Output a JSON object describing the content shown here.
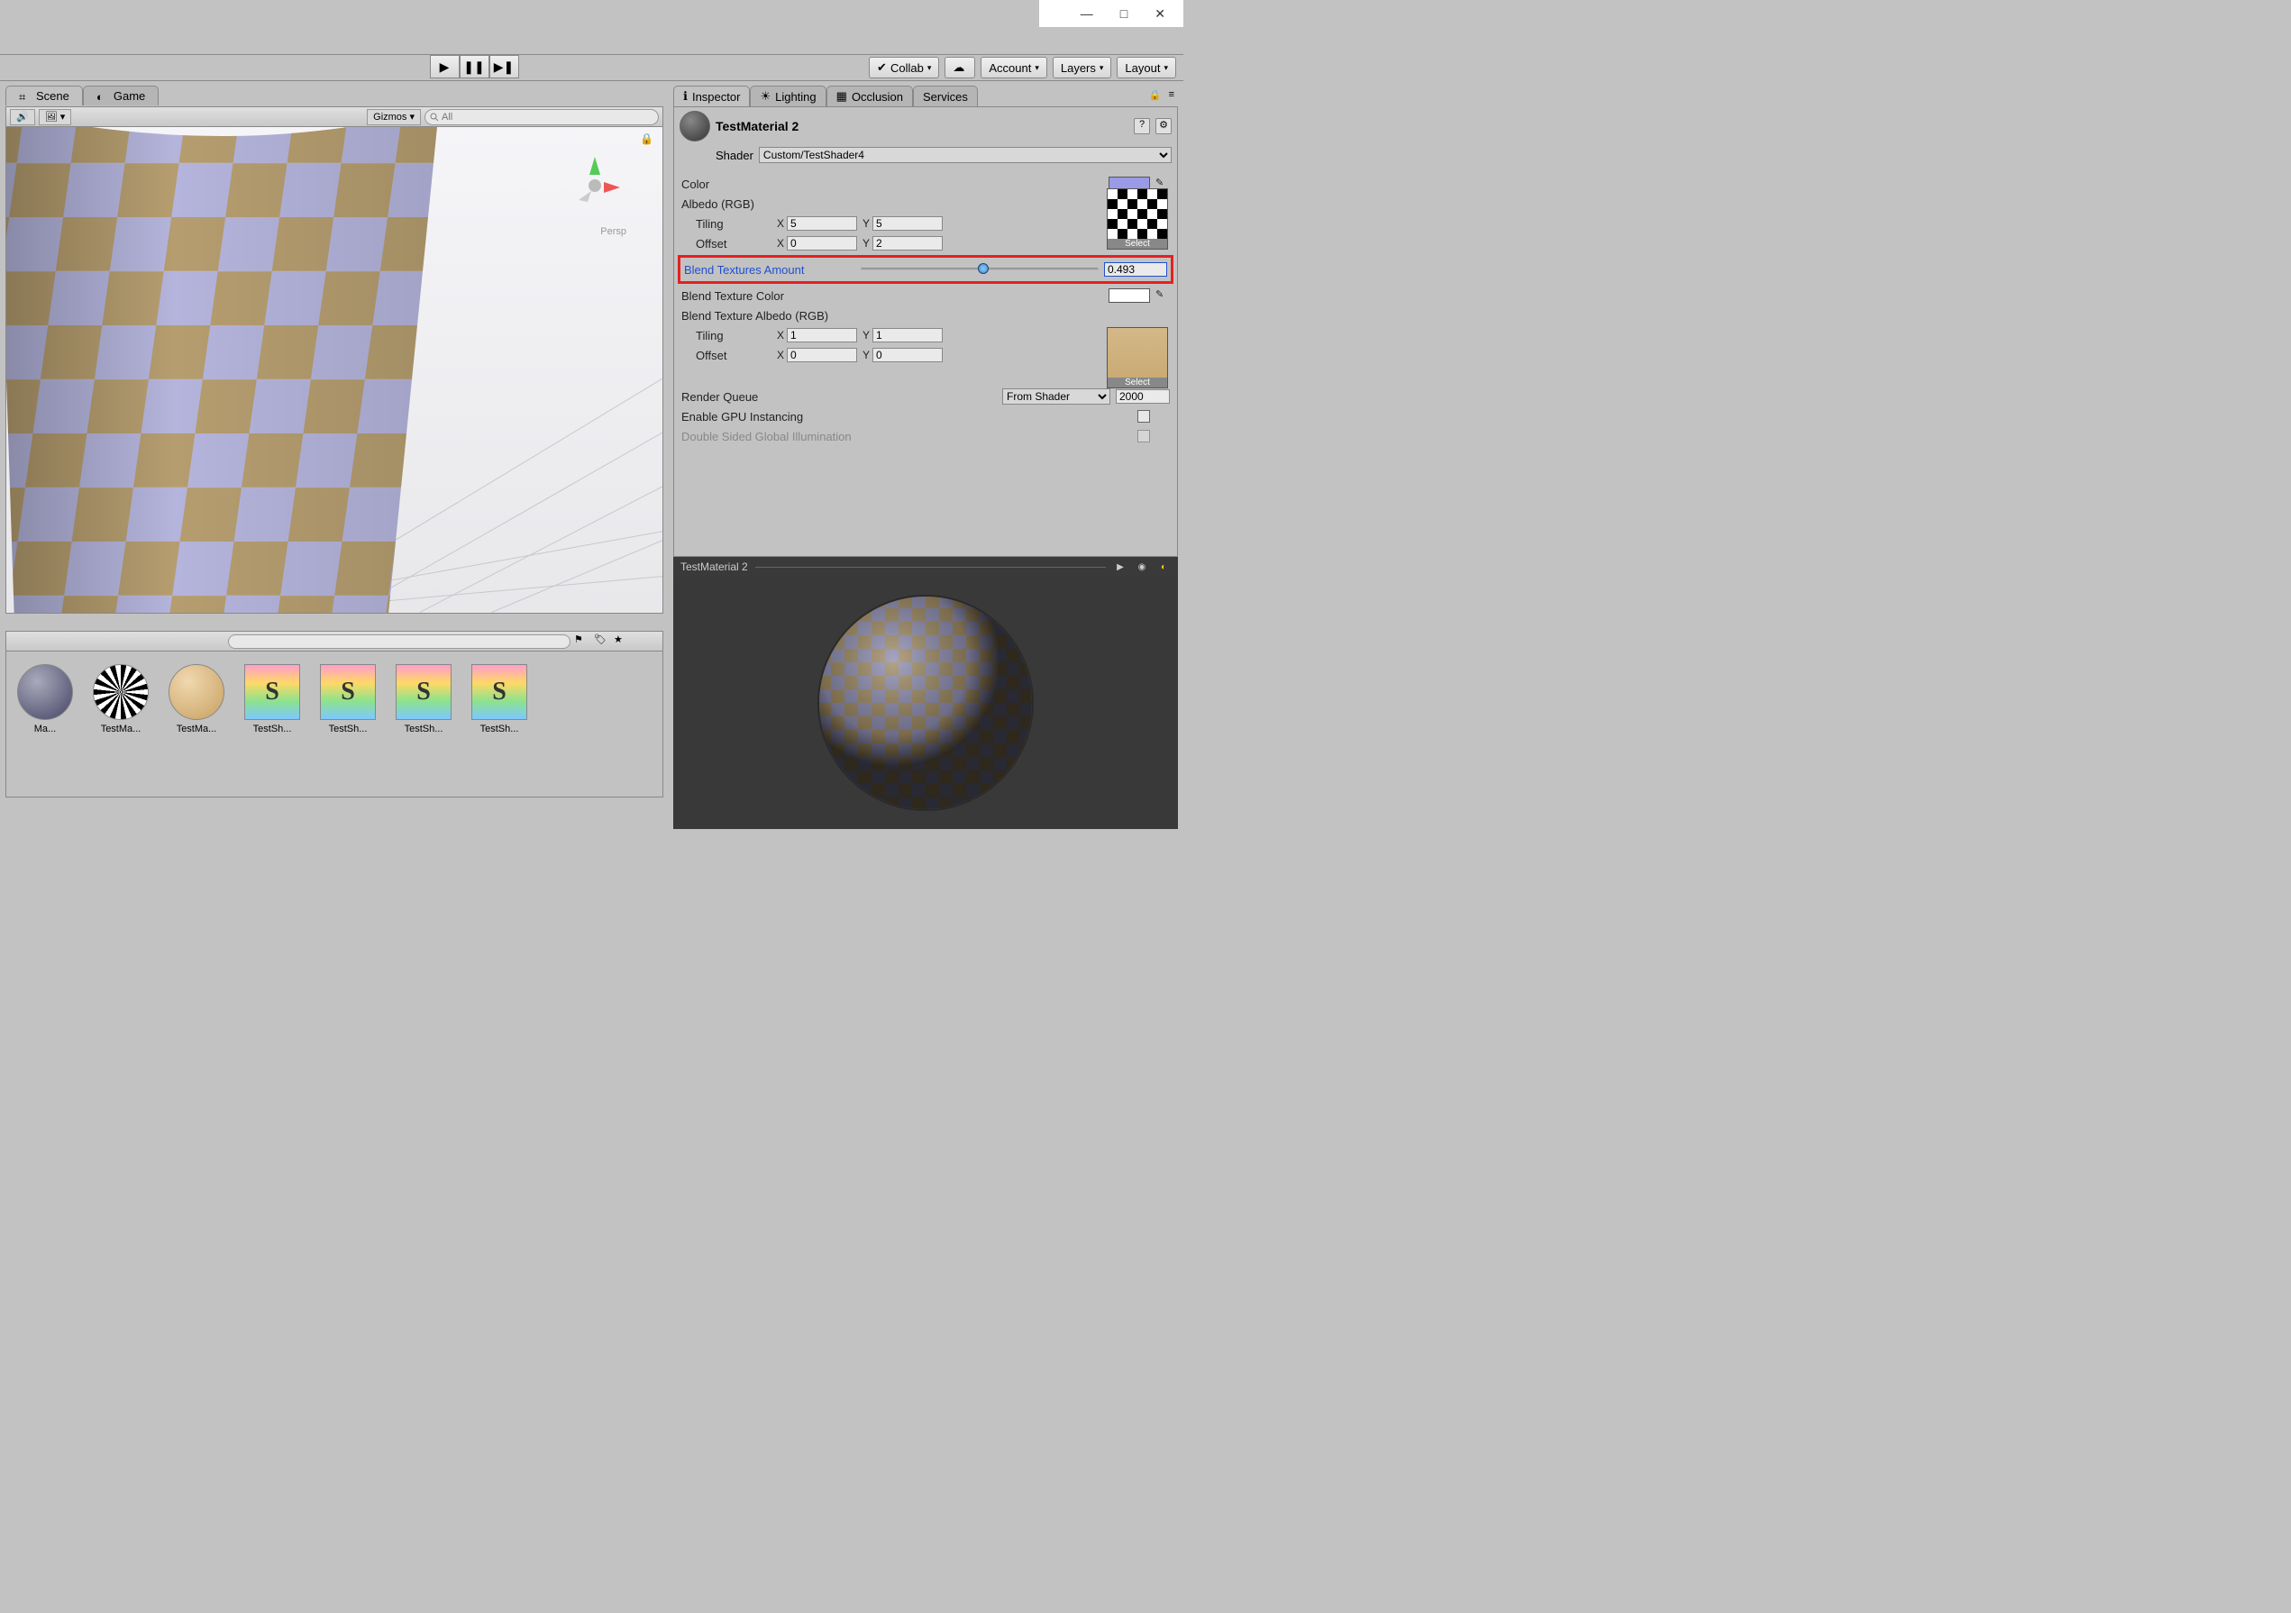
{
  "window": {
    "minimize": "—",
    "maximize": "□",
    "close": "✕"
  },
  "top": {
    "collab": "Collab",
    "account": "Account",
    "layers": "Layers",
    "layout": "Layout"
  },
  "left_tabs": {
    "scene": "Scene",
    "game": "Game"
  },
  "scene_toolbar": {
    "gizmos": "Gizmos",
    "search_placeholder": "All"
  },
  "gizmo_label": "Persp",
  "inspector_tabs": {
    "inspector": "Inspector",
    "lighting": "Lighting",
    "occlusion": "Occlusion",
    "services": "Services"
  },
  "material": {
    "name": "TestMaterial 2",
    "shader_label": "Shader",
    "shader_value": "Custom/TestShader4",
    "help": "?",
    "gear": "⚙"
  },
  "props": {
    "color_label": "Color",
    "color_value": "#9a9ae6",
    "albedo_label": "Albedo (RGB)",
    "tiling_label": "Tiling",
    "offset_label": "Offset",
    "x_label": "X",
    "y_label": "Y",
    "tiling1_x": "5",
    "tiling1_y": "5",
    "offset1_x": "0",
    "offset1_y": "2",
    "blend_label": "Blend Textures Amount",
    "blend_value": "0.493",
    "blend_tex_color_label": "Blend Texture Color",
    "blend_tex_color_value": "#ffffff",
    "blend_tex_albedo_label": "Blend Texture Albedo (RGB)",
    "tiling2_x": "1",
    "tiling2_y": "1",
    "offset2_x": "0",
    "offset2_y": "0",
    "select_label": "Select",
    "render_queue_label": "Render Queue",
    "render_queue_source": "From Shader",
    "render_queue_value": "2000",
    "gpu_instancing_label": "Enable GPU Instancing",
    "double_sided_gi_label": "Double Sided Global Illumination"
  },
  "preview": {
    "title": "TestMaterial 2"
  },
  "assets": [
    {
      "label": "Ma...",
      "type": "sphere-blue"
    },
    {
      "label": "TestMa...",
      "type": "sphere-checker"
    },
    {
      "label": "TestMa...",
      "type": "sphere-wood"
    },
    {
      "label": "TestSh...",
      "type": "shader"
    },
    {
      "label": "TestSh...",
      "type": "shader"
    },
    {
      "label": "TestSh...",
      "type": "shader"
    },
    {
      "label": "TestSh...",
      "type": "shader"
    }
  ]
}
